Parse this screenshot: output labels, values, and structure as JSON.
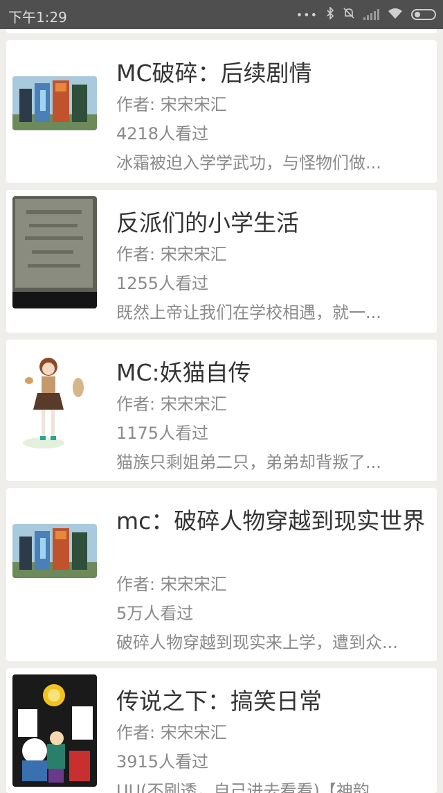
{
  "status_bar": {
    "time": "下午1:29",
    "icons": [
      "dots-icon",
      "bluetooth-icon",
      "mute-icon",
      "signal-icon",
      "wifi-icon",
      "battery-icon"
    ]
  },
  "stories": [
    {
      "title": "MC破碎：后续剧情",
      "author": "作者: 宋宋宋汇",
      "views": "4218人看过",
      "summary": "冰霜被迫入学学武功，与怪物们做..."
    },
    {
      "title": "反派们的小学生活",
      "author": "作者: 宋宋宋汇",
      "views": "1255人看过",
      "summary": "既然上帝让我们在学校相遇，就一..."
    },
    {
      "title": "MC:妖猫自传",
      "author": "作者: 宋宋宋汇",
      "views": "1175人看过",
      "summary": "猫族只剩姐弟二只，弟弟却背叛了..."
    },
    {
      "title": "mc：破碎人物穿越到现实世界",
      "author": "作者: 宋宋宋汇",
      "views": "5万人看过",
      "summary": "破碎人物穿越到现实来上学，遭到众..."
    },
    {
      "title": "传说之下：搞笑日常",
      "author": "作者: 宋宋宋汇",
      "views": "3915人看过",
      "summary": "UU(不刷透，自己进去看看)【神韵"
    }
  ]
}
